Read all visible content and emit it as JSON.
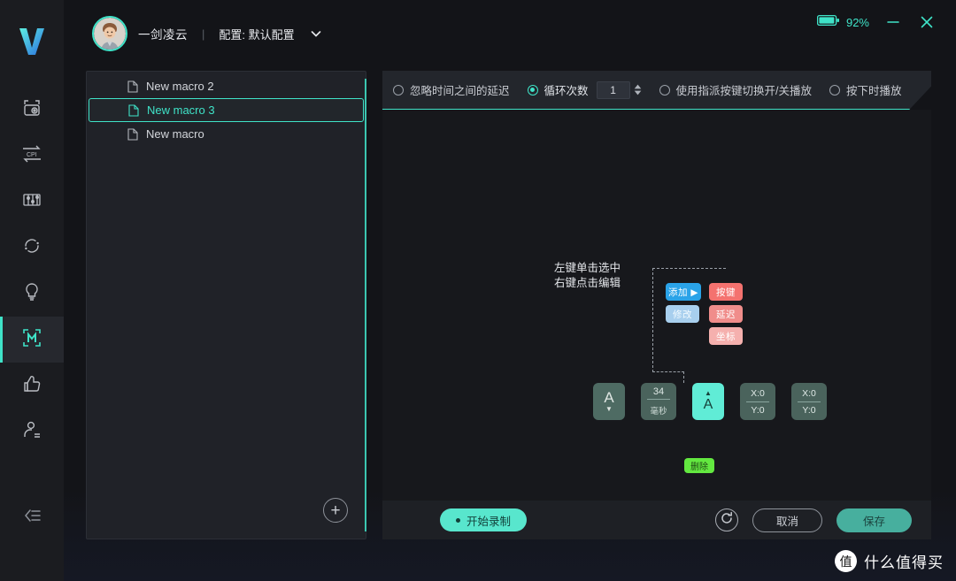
{
  "window": {
    "battery_label": "92%",
    "battery_icon": "battery-icon",
    "minimize_label": "–",
    "close_label": "✕"
  },
  "header": {
    "logo_icon": "app-logo-v",
    "avatar_icon": "user-avatar",
    "username": "一剑凌云",
    "separator": "|",
    "config_label": "配置: 默认配置",
    "config_chevron_icon": "chevron-down-icon"
  },
  "sidebar": {
    "items": [
      {
        "icon": "device-settings-icon",
        "active": false
      },
      {
        "icon": "cpi-icon",
        "active": false
      },
      {
        "icon": "sliders-icon",
        "active": false
      },
      {
        "icon": "sync-icon",
        "active": false
      },
      {
        "icon": "lightbulb-icon",
        "active": false
      },
      {
        "icon": "macro-m-icon",
        "active": true
      },
      {
        "icon": "thumbs-up-icon",
        "active": false
      },
      {
        "icon": "user-profile-icon",
        "active": false
      }
    ],
    "collapse_icon": "collapse-sidebar-icon"
  },
  "macro_list": {
    "items": [
      {
        "label": "New macro 2",
        "selected": false
      },
      {
        "label": "New macro 3",
        "selected": true
      },
      {
        "label": "New macro",
        "selected": false
      }
    ],
    "add_label": "+",
    "add_icon": "plus-circle-icon",
    "file_icon": "file-icon"
  },
  "options": {
    "ignore_delay": {
      "label": "忽略时间之间的延迟",
      "selected": false
    },
    "loop_count": {
      "label": "循环次数",
      "selected": true,
      "value": "1"
    },
    "toggle_play": {
      "label": "使用指派按键切换开/关播放",
      "selected": false
    },
    "press_play": {
      "label": "按下时播放",
      "selected": false
    },
    "spinner_up_icon": "spinner-up-icon",
    "spinner_down_icon": "spinner-down-icon"
  },
  "canvas": {
    "annotation_line1": "左键单击选中",
    "annotation_line2": "右键点击编辑",
    "context_menu": {
      "add_label": "添加 ▶",
      "modify_label": "修改",
      "submenu": [
        {
          "label": "按键"
        },
        {
          "label": "延迟"
        },
        {
          "label": "坐标"
        }
      ]
    },
    "delete_label": "删除",
    "steps": [
      {
        "type": "key-down",
        "key": "A",
        "arrow": "▼",
        "selected": false
      },
      {
        "type": "delay",
        "value": "34",
        "unit": "毫秒",
        "selected": false
      },
      {
        "type": "key-up",
        "key": "A",
        "arrow": "▲",
        "selected": true
      },
      {
        "type": "coordinate",
        "x": "X:0",
        "y": "Y:0",
        "selected": false
      },
      {
        "type": "coordinate",
        "x": "X:0",
        "y": "Y:0",
        "selected": false
      }
    ]
  },
  "bottom": {
    "record_label": "开始录制",
    "refresh_icon": "refresh-icon",
    "cancel_label": "取消",
    "save_label": "保存"
  },
  "watermark": {
    "badge": "值",
    "text": "什么值得买"
  },
  "colors": {
    "accent": "#3fe3c8",
    "accent_solid": "#58e6cd",
    "bg": "#17181c",
    "panel": "#202228",
    "rail": "#1b1c20"
  }
}
